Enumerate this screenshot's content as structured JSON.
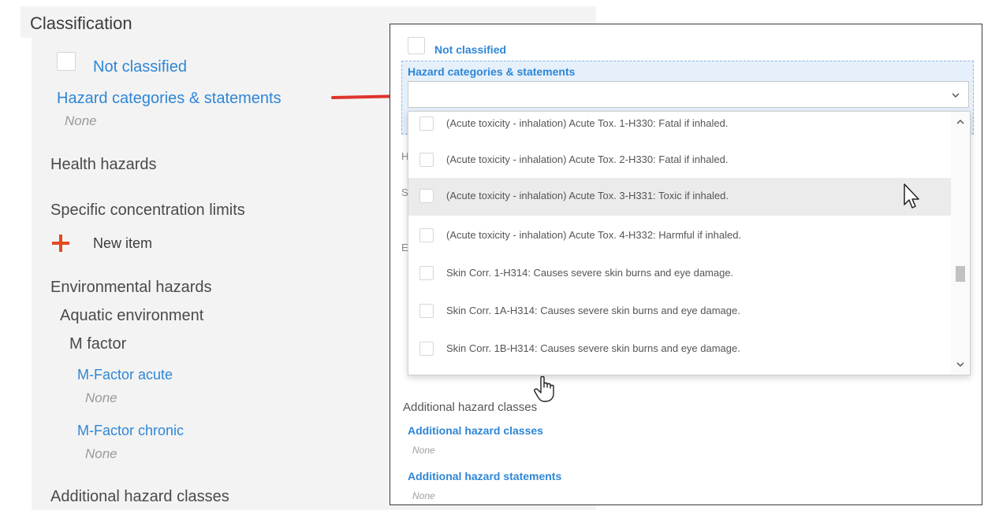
{
  "left": {
    "title": "Classification",
    "not_classified": "Not classified",
    "hazard_categories_label": "Hazard categories & statements",
    "hazard_categories_value": "None",
    "health_hazards": "Health hazards",
    "specific_concentration_limits": "Specific concentration limits",
    "new_item": "New item",
    "environmental_hazards": "Environmental hazards",
    "aquatic_environment": "Aquatic environment",
    "m_factor": "M factor",
    "m_factor_acute_label": "M-Factor acute",
    "m_factor_acute_value": "None",
    "m_factor_chronic_label": "M-Factor chronic",
    "m_factor_chronic_value": "None",
    "additional_hazard_classes": "Additional hazard classes"
  },
  "right": {
    "not_classified": "Not classified",
    "hazard_categories_label": "Hazard categories & statements",
    "select_value": "",
    "options": [
      {
        "label": "(Acute toxicity - inhalation) Acute Tox. 1-H330: Fatal if inhaled.",
        "checked": false
      },
      {
        "label": "(Acute toxicity - inhalation) Acute Tox. 2-H330: Fatal if inhaled.",
        "checked": false
      },
      {
        "label": "(Acute toxicity - inhalation) Acute Tox. 3-H331: Toxic if inhaled.",
        "checked": false
      },
      {
        "label": "(Acute toxicity - inhalation) Acute Tox. 4-H332: Harmful if inhaled.",
        "checked": false
      },
      {
        "label": "Skin Corr. 1-H314: Causes severe skin burns and eye damage.",
        "checked": false
      },
      {
        "label": "Skin Corr. 1A-H314: Causes severe skin burns and eye damage.",
        "checked": false
      },
      {
        "label": "Skin Corr. 1B-H314: Causes severe skin burns and eye damage.",
        "checked": false
      }
    ],
    "hovered_option_index": 2,
    "behind_letters": [
      "H",
      "S",
      "E"
    ],
    "additional_hazard_classes_heading": "Additional hazard classes",
    "additional_hazard_classes_label": "Additional hazard classes",
    "additional_hazard_classes_value": "None",
    "additional_hazard_statements_label": "Additional hazard statements",
    "additional_hazard_statements_value": "None"
  },
  "colors": {
    "link_blue": "#2e86d6",
    "arrow_red": "#e0342c",
    "plus_orange": "#e24a1f",
    "panel_grey": "#f3f3f3",
    "highlight_blue": "#e5f0fb"
  },
  "icons": {
    "arrow": "red-arrow-icon",
    "plus": "plus-icon",
    "chevron": "chevron-down-icon",
    "cursor": "mouse-pointer-icon",
    "hand": "hand-pointer-icon"
  }
}
